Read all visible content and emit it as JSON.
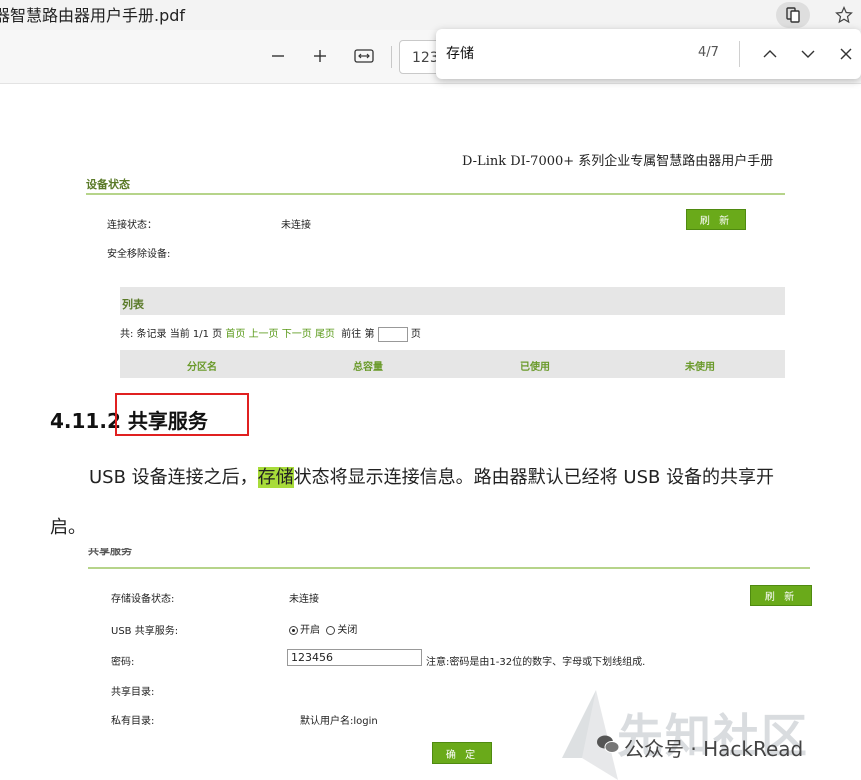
{
  "window": {
    "title": "器智慧路由器用户手册.pdf"
  },
  "toolbar": {
    "page_number": "123"
  },
  "find": {
    "query": "存储",
    "count": "4/7"
  },
  "document": {
    "running_header": "D-Link  DI-7000+  系列企业专属智慧路由器用户手册",
    "device_status": {
      "heading": "设备状态",
      "connection_label": "连接状态：",
      "connection_value": "未连接",
      "refresh_label": "刷 新",
      "safe_remove_label": "安全移除设备:",
      "list_heading": "列表",
      "pager": {
        "prefix": "共: 条记录 当前 1/1 页",
        "first": "首页",
        "prev": "上一页",
        "next": "下一页",
        "last": "尾页",
        "goto": "前往 第",
        "page_suffix": "页"
      },
      "columns": [
        "分区名",
        "总容量",
        "已使用",
        "未使用"
      ]
    },
    "section_number": "4.11.2",
    "section_title": "共享服务",
    "para_before": "USB 设备连接之后，",
    "para_highlight": "存储",
    "para_after": "状态将显示连接信息。路由器默认已经将 USB 设备的共享开",
    "para_line2": "启。",
    "share": {
      "partial_heading": "共享服务",
      "storage_status_label": "存储设备状态:",
      "storage_status_value": "未连接",
      "refresh_label": "刷 新",
      "usb_share_label": "USB 共享服务:",
      "on_label": "开启",
      "off_label": "关闭",
      "password_label": "密码:",
      "password_value": "123456",
      "password_note": "注意:密码是由1-32位的数字、字母或下划线组成.",
      "shared_dir_label": "共享目录:",
      "private_dir_label": "私有目录:",
      "private_dir_value": "默认用户名:login",
      "confirm_label": "确 定"
    }
  },
  "watermark": {
    "large": "先知社区",
    "small": "公众号 · HackRead"
  },
  "colors": {
    "accent_green": "#6aaa1a",
    "highlight": "#a8dc3a",
    "annotation_red": "#e02020"
  }
}
